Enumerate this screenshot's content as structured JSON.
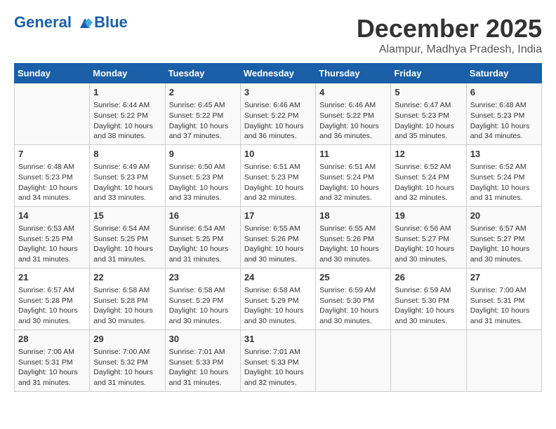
{
  "header": {
    "logo_line1": "General",
    "logo_line2": "Blue",
    "month": "December 2025",
    "location": "Alampur, Madhya Pradesh, India"
  },
  "days_of_week": [
    "Sunday",
    "Monday",
    "Tuesday",
    "Wednesday",
    "Thursday",
    "Friday",
    "Saturday"
  ],
  "weeks": [
    [
      {
        "day": "",
        "info": ""
      },
      {
        "day": "1",
        "info": "Sunrise: 6:44 AM\nSunset: 5:22 PM\nDaylight: 10 hours\nand 38 minutes."
      },
      {
        "day": "2",
        "info": "Sunrise: 6:45 AM\nSunset: 5:22 PM\nDaylight: 10 hours\nand 37 minutes."
      },
      {
        "day": "3",
        "info": "Sunrise: 6:46 AM\nSunset: 5:22 PM\nDaylight: 10 hours\nand 36 minutes."
      },
      {
        "day": "4",
        "info": "Sunrise: 6:46 AM\nSunset: 5:22 PM\nDaylight: 10 hours\nand 36 minutes."
      },
      {
        "day": "5",
        "info": "Sunrise: 6:47 AM\nSunset: 5:23 PM\nDaylight: 10 hours\nand 35 minutes."
      },
      {
        "day": "6",
        "info": "Sunrise: 6:48 AM\nSunset: 5:23 PM\nDaylight: 10 hours\nand 34 minutes."
      }
    ],
    [
      {
        "day": "7",
        "info": "Sunrise: 6:48 AM\nSunset: 5:23 PM\nDaylight: 10 hours\nand 34 minutes."
      },
      {
        "day": "8",
        "info": "Sunrise: 6:49 AM\nSunset: 5:23 PM\nDaylight: 10 hours\nand 33 minutes."
      },
      {
        "day": "9",
        "info": "Sunrise: 6:50 AM\nSunset: 5:23 PM\nDaylight: 10 hours\nand 33 minutes."
      },
      {
        "day": "10",
        "info": "Sunrise: 6:51 AM\nSunset: 5:23 PM\nDaylight: 10 hours\nand 32 minutes."
      },
      {
        "day": "11",
        "info": "Sunrise: 6:51 AM\nSunset: 5:24 PM\nDaylight: 10 hours\nand 32 minutes."
      },
      {
        "day": "12",
        "info": "Sunrise: 6:52 AM\nSunset: 5:24 PM\nDaylight: 10 hours\nand 32 minutes."
      },
      {
        "day": "13",
        "info": "Sunrise: 6:52 AM\nSunset: 5:24 PM\nDaylight: 10 hours\nand 31 minutes."
      }
    ],
    [
      {
        "day": "14",
        "info": "Sunrise: 6:53 AM\nSunset: 5:25 PM\nDaylight: 10 hours\nand 31 minutes."
      },
      {
        "day": "15",
        "info": "Sunrise: 6:54 AM\nSunset: 5:25 PM\nDaylight: 10 hours\nand 31 minutes."
      },
      {
        "day": "16",
        "info": "Sunrise: 6:54 AM\nSunset: 5:25 PM\nDaylight: 10 hours\nand 31 minutes."
      },
      {
        "day": "17",
        "info": "Sunrise: 6:55 AM\nSunset: 5:26 PM\nDaylight: 10 hours\nand 30 minutes."
      },
      {
        "day": "18",
        "info": "Sunrise: 6:55 AM\nSunset: 5:26 PM\nDaylight: 10 hours\nand 30 minutes."
      },
      {
        "day": "19",
        "info": "Sunrise: 6:56 AM\nSunset: 5:27 PM\nDaylight: 10 hours\nand 30 minutes."
      },
      {
        "day": "20",
        "info": "Sunrise: 6:57 AM\nSunset: 5:27 PM\nDaylight: 10 hours\nand 30 minutes."
      }
    ],
    [
      {
        "day": "21",
        "info": "Sunrise: 6:57 AM\nSunset: 5:28 PM\nDaylight: 10 hours\nand 30 minutes."
      },
      {
        "day": "22",
        "info": "Sunrise: 6:58 AM\nSunset: 5:28 PM\nDaylight: 10 hours\nand 30 minutes."
      },
      {
        "day": "23",
        "info": "Sunrise: 6:58 AM\nSunset: 5:29 PM\nDaylight: 10 hours\nand 30 minutes."
      },
      {
        "day": "24",
        "info": "Sunrise: 6:58 AM\nSunset: 5:29 PM\nDaylight: 10 hours\nand 30 minutes."
      },
      {
        "day": "25",
        "info": "Sunrise: 6:59 AM\nSunset: 5:30 PM\nDaylight: 10 hours\nand 30 minutes."
      },
      {
        "day": "26",
        "info": "Sunrise: 6:59 AM\nSunset: 5:30 PM\nDaylight: 10 hours\nand 30 minutes."
      },
      {
        "day": "27",
        "info": "Sunrise: 7:00 AM\nSunset: 5:31 PM\nDaylight: 10 hours\nand 31 minutes."
      }
    ],
    [
      {
        "day": "28",
        "info": "Sunrise: 7:00 AM\nSunset: 5:31 PM\nDaylight: 10 hours\nand 31 minutes."
      },
      {
        "day": "29",
        "info": "Sunrise: 7:00 AM\nSunset: 5:32 PM\nDaylight: 10 hours\nand 31 minutes."
      },
      {
        "day": "30",
        "info": "Sunrise: 7:01 AM\nSunset: 5:33 PM\nDaylight: 10 hours\nand 31 minutes."
      },
      {
        "day": "31",
        "info": "Sunrise: 7:01 AM\nSunset: 5:33 PM\nDaylight: 10 hours\nand 32 minutes."
      },
      {
        "day": "",
        "info": ""
      },
      {
        "day": "",
        "info": ""
      },
      {
        "day": "",
        "info": ""
      }
    ]
  ]
}
